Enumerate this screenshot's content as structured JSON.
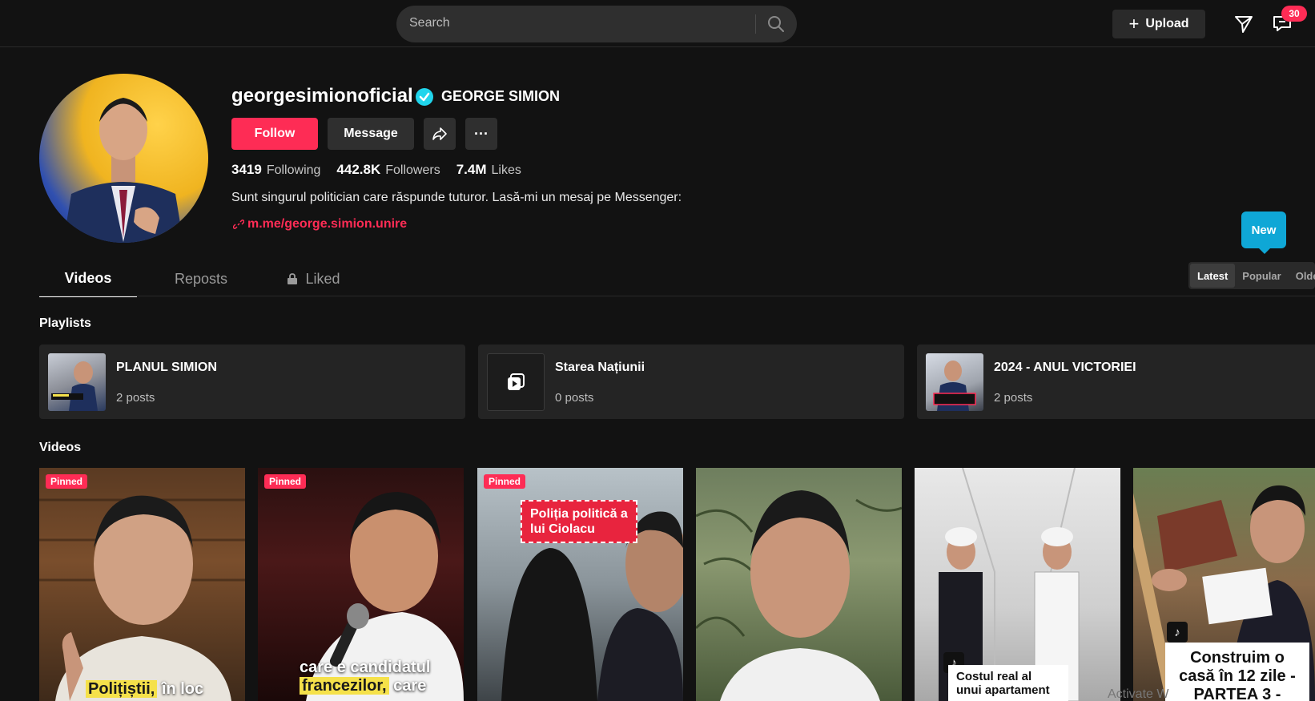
{
  "header": {
    "search_placeholder": "Search",
    "upload_label": "Upload",
    "inbox_badge": "30"
  },
  "profile": {
    "username": "georgesimionoficial",
    "display_name": "GEORGE SIMION",
    "follow_label": "Follow",
    "message_label": "Message",
    "stats": {
      "following": "3419",
      "following_label": "Following",
      "followers": "442.8K",
      "followers_label": "Followers",
      "likes": "7.4M",
      "likes_label": "Likes"
    },
    "bio": "Sunt singurul politician care răspunde tuturor. Lasă-mi un mesaj pe Messenger:",
    "link": "m.me/george.simion.unire"
  },
  "tabs": [
    "Videos",
    "Reposts",
    "Liked"
  ],
  "new_bubble": "New",
  "sort_options": [
    "Latest",
    "Popular",
    "Oldest"
  ],
  "playlists_title": "Playlists",
  "playlists": [
    {
      "name": "PLANUL SIMION",
      "count": "2 posts"
    },
    {
      "name": "Starea Națiunii",
      "count": "0 posts"
    },
    {
      "name": "2024 - ANUL VICTORIEI",
      "count": "2 posts"
    }
  ],
  "videos_title": "Videos",
  "videos": [
    {
      "pinned": "Pinned",
      "caption_hl": "Polițiștii,",
      "caption_rest": " în loc"
    },
    {
      "pinned": "Pinned",
      "caption_line1": "care e candidatul",
      "caption_hl": "francezilor,",
      "caption_rest": " care"
    },
    {
      "pinned": "Pinned",
      "tag": "Poliția politică a lui Ciolacu"
    },
    {},
    {
      "title": "Costul real al unui apartament"
    },
    {
      "title": "Construim o casă în 12 zile - PARTEA 3 -"
    }
  ],
  "watermark": "Activate W",
  "colors": {
    "accent": "#fe2c55",
    "verified": "#20d5ec",
    "new_bubble": "#0fa7d6"
  }
}
